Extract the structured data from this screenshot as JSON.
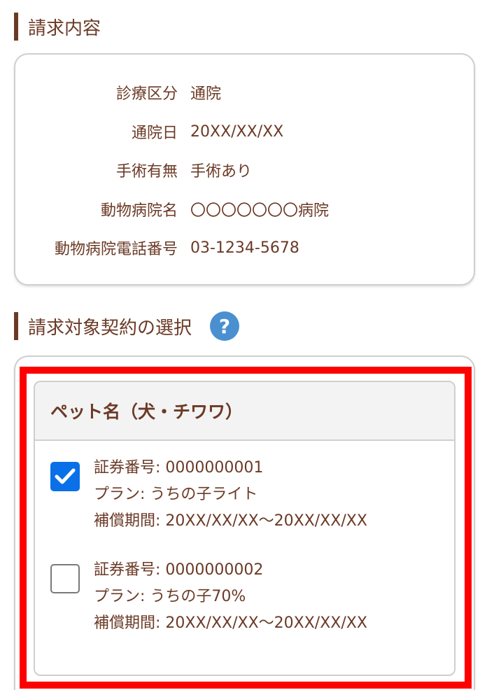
{
  "billing": {
    "heading": "請求内容",
    "rows": [
      {
        "label": "診療区分",
        "value": "通院"
      },
      {
        "label": "通院日",
        "value": "20XX/XX/XX"
      },
      {
        "label": "手術有無",
        "value": "手術あり"
      },
      {
        "label": "動物病院名",
        "value": "〇〇〇〇〇〇〇病院"
      },
      {
        "label": "動物病院電話番号",
        "value": "03-1234-5678"
      }
    ]
  },
  "contract_selection": {
    "heading": "請求対象契約の選択",
    "help_icon": "question-icon",
    "help_symbol": "?",
    "pet_name": "ペット名（犬・チワワ）",
    "policies": [
      {
        "checked": true,
        "number": "証券番号: 0000000001",
        "plan": "プラン: うちの子ライト",
        "period": "補償期間: 20XX/XX/XX〜20XX/XX/XX"
      },
      {
        "checked": false,
        "number": "証券番号: 0000000002",
        "plan": "プラン: うちの子70%",
        "period": "補償期間: 20XX/XX/XX〜20XX/XX/XX"
      }
    ]
  },
  "colors": {
    "text_brown": "#6b3a26",
    "accent_blue": "#0a70e8",
    "help_blue": "#4a90d0",
    "highlight_red": "#ff0000"
  }
}
